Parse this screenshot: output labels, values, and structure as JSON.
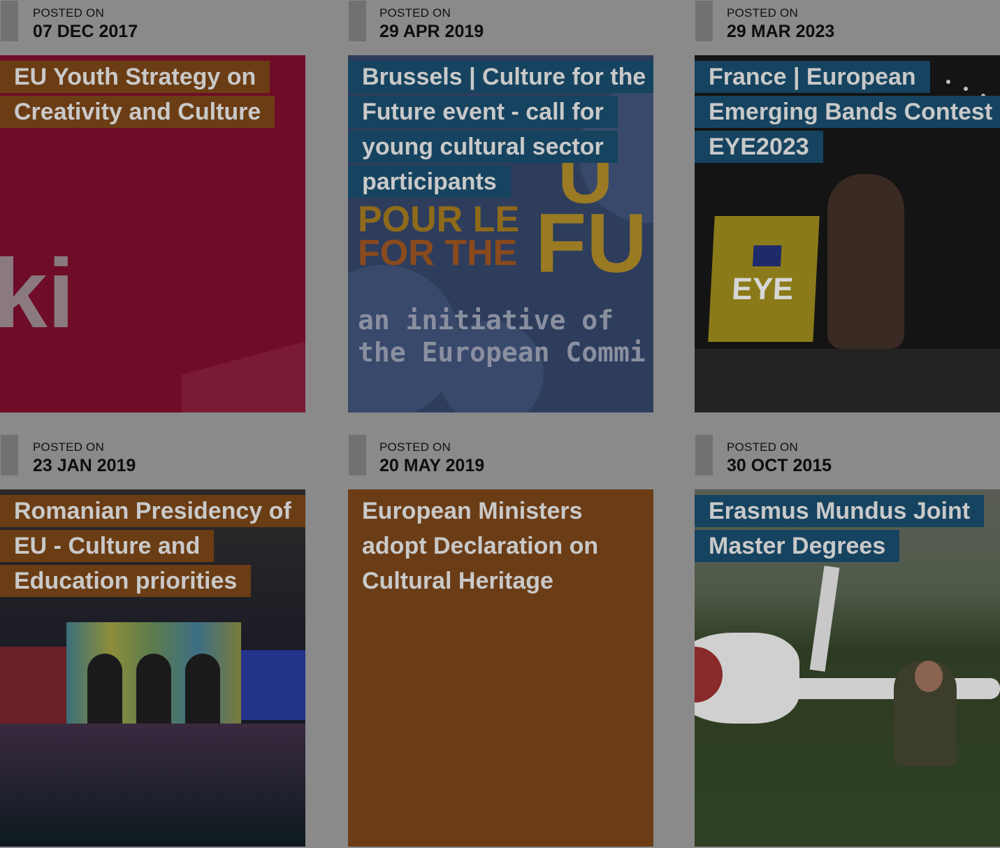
{
  "posted_label": "POSTED ON",
  "cards": [
    {
      "date": "07 DEC 2017",
      "title": "EU Youth Strategy on Creativity and Culture",
      "title_style": "orange",
      "image_text": "ki"
    },
    {
      "date": "29 APR 2019",
      "title": "Brussels | Culture for the Future event - call for young cultural sector participants",
      "title_style": "blue",
      "image_text": {
        "big_u": "U",
        "pour": "POUR LE",
        "for_the": "FOR THE",
        "fu": "FU",
        "initiative_line1": "an initiative of",
        "initiative_line2": "the European Commi"
      }
    },
    {
      "date": "29 MAR 2023",
      "title": "France | European Emerging Bands Contest EYE2023",
      "title_style": "blue",
      "image_text": "EYE"
    },
    {
      "date": "23 JAN 2019",
      "title": "Romanian Presidency of EU - Culture and Education priorities",
      "title_style": "orange"
    },
    {
      "date": "20 MAY 2019",
      "title": "European Ministers adopt Declaration on Cultural Heritage",
      "title_style": "plain"
    },
    {
      "date": "30 OCT 2015",
      "title": "Erasmus Mundus Joint Master Degrees",
      "title_style": "blue"
    }
  ],
  "colors": {
    "orange_label": "#6b3d14",
    "blue_label": "#16435f",
    "overlay": "#8a8a8a"
  }
}
